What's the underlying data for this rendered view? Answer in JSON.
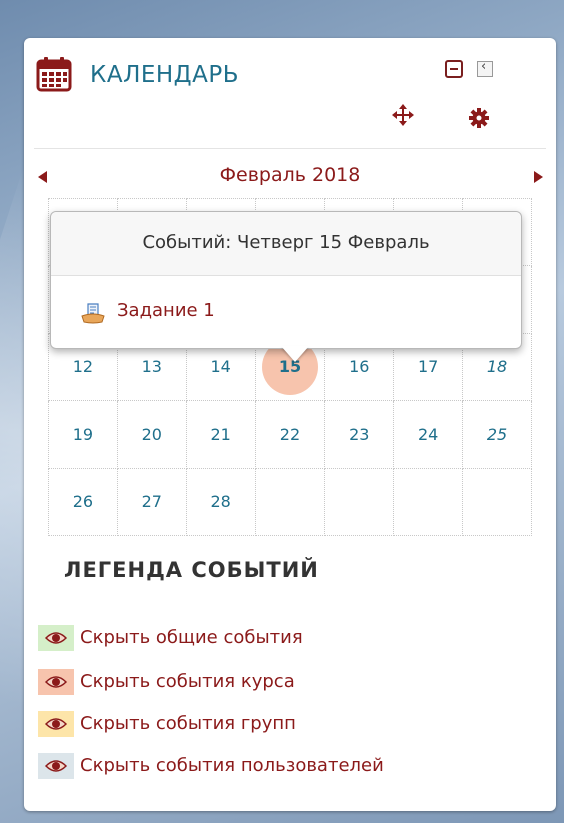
{
  "block": {
    "title": "КАЛЕНДАРЬ",
    "controls": [
      "hide-icon",
      "dock-icon",
      "move-icon",
      "gear-icon"
    ]
  },
  "calendar": {
    "month_label": "Февраль 2018",
    "rows": [
      [
        "12",
        "13",
        "14",
        "15",
        "16",
        "17",
        "18"
      ],
      [
        "19",
        "20",
        "21",
        "22",
        "23",
        "24",
        "25"
      ],
      [
        "26",
        "27",
        "28",
        "",
        "",
        "",
        ""
      ]
    ],
    "today": "15"
  },
  "popup": {
    "title": "Событий: Четверг 15 Февраль",
    "event": "Задание 1"
  },
  "legend": {
    "title": "ЛЕГЕНДА СОБЫТИЙ",
    "items": [
      {
        "label": "Скрыть общие события",
        "color": "#d5efc9"
      },
      {
        "label": "Скрыть события курса",
        "color": "#f7c4ad"
      },
      {
        "label": "Скрыть события групп",
        "color": "#fde5a9"
      },
      {
        "label": "Скрыть события пользователей",
        "color": "#dce5ea"
      }
    ]
  },
  "colors": {
    "title": "#1f6f8b",
    "link": "#8b1a1a",
    "today": "#f7c4ad"
  }
}
